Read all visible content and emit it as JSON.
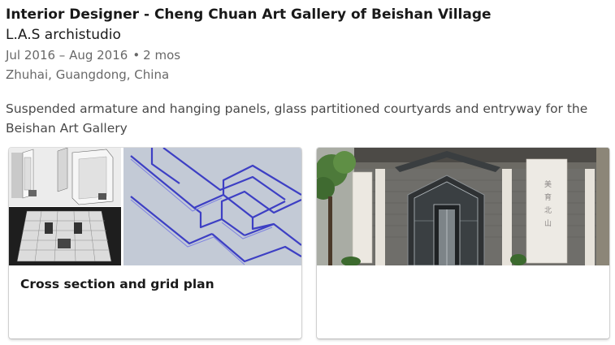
{
  "position": {
    "title": "Interior Designer - Cheng Chuan Art Gallery of Beishan Village",
    "company": "L.A.S archistudio",
    "date_range": "Jul 2016 – Aug 2016",
    "bullet": "•",
    "duration": "2 mos",
    "location": "Zhuhai, Guangdong, China",
    "description": "Suspended armature and hanging panels, glass partitioned courtyards and entryway for the Beishan Art Gallery"
  },
  "media": [
    {
      "title": "Cross section and grid plan"
    },
    {
      "title": ""
    }
  ],
  "banner_text": "美育北山"
}
